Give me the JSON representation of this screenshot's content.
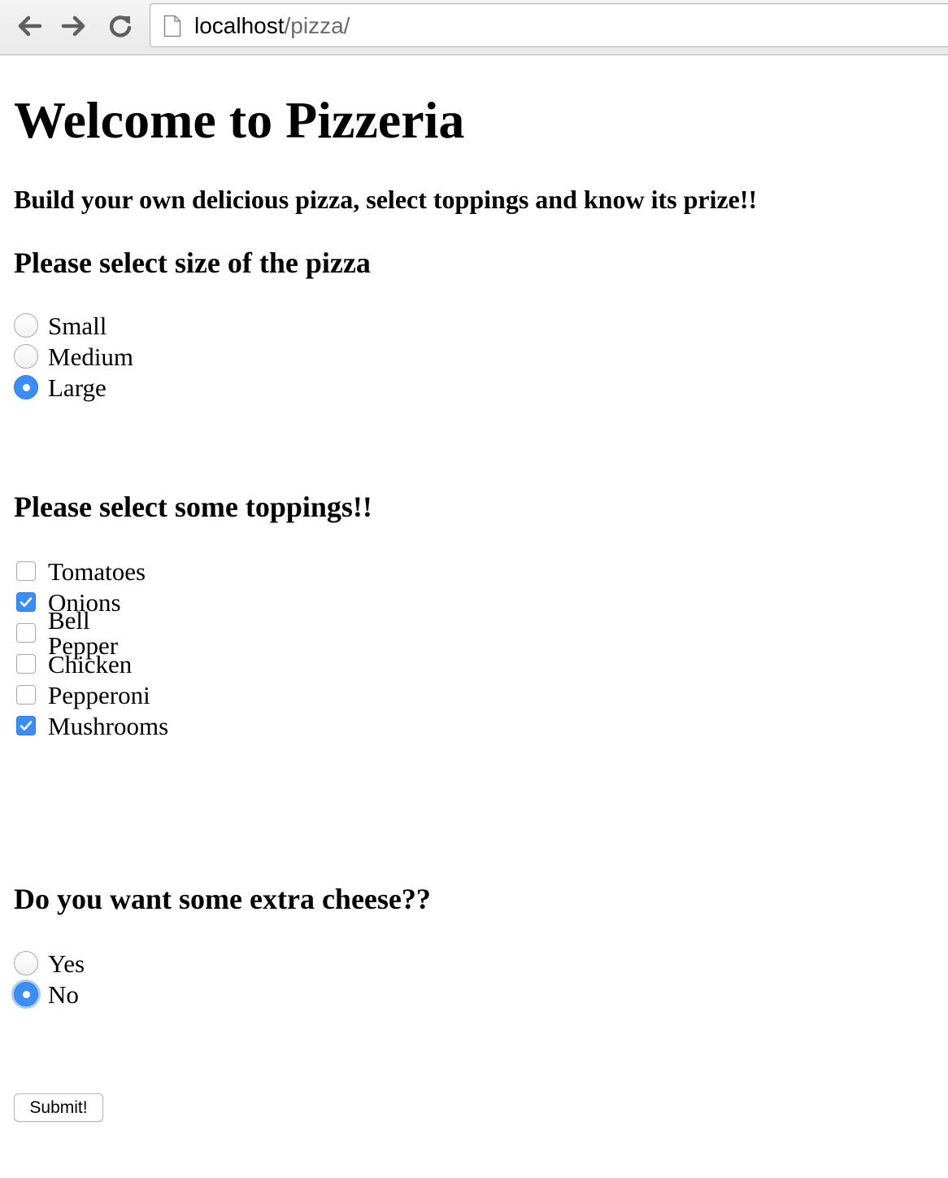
{
  "browser": {
    "url_host": "localhost",
    "url_path": "/pizza/",
    "back_icon": "arrow-left-icon",
    "forward_icon": "arrow-right-icon",
    "reload_icon": "reload-icon",
    "page_icon": "page-icon"
  },
  "page": {
    "title": "Welcome to Pizzeria",
    "subtitle": "Build your own delicious pizza, select toppings and know its prize!!"
  },
  "size_section": {
    "heading": "Please select size of the pizza",
    "selected": "Large",
    "options": [
      {
        "label": "Small",
        "checked": false
      },
      {
        "label": "Medium",
        "checked": false
      },
      {
        "label": "Large",
        "checked": true
      }
    ]
  },
  "toppings_section": {
    "heading": "Please select some toppings!!",
    "options": [
      {
        "label": "Tomatoes",
        "checked": false
      },
      {
        "label": "Onions",
        "checked": true
      },
      {
        "label": "Bell Pepper",
        "checked": false
      },
      {
        "label": "Chicken",
        "checked": false
      },
      {
        "label": "Pepperoni",
        "checked": false
      },
      {
        "label": "Mushrooms",
        "checked": true
      }
    ]
  },
  "cheese_section": {
    "heading": "Do you want some extra cheese??",
    "selected": "No",
    "options": [
      {
        "label": "Yes",
        "checked": false
      },
      {
        "label": "No",
        "checked": true
      }
    ]
  },
  "submit_label": "Submit!",
  "colors": {
    "accent": "#3a8ef6",
    "chrome_bg": "#eeeeee",
    "url_path": "#6b6b6b"
  }
}
